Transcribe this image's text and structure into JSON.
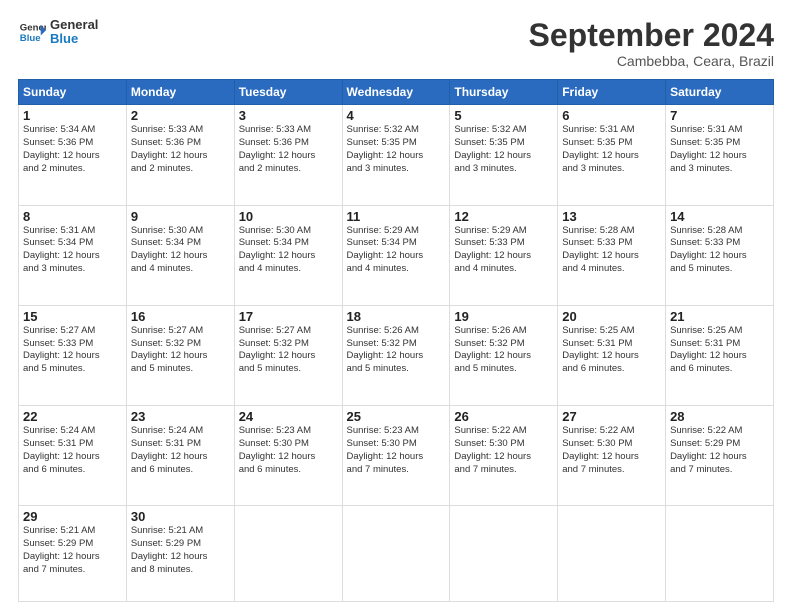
{
  "header": {
    "logo_general": "General",
    "logo_blue": "Blue",
    "month": "September 2024",
    "location": "Cambebba, Ceara, Brazil"
  },
  "days_of_week": [
    "Sunday",
    "Monday",
    "Tuesday",
    "Wednesday",
    "Thursday",
    "Friday",
    "Saturday"
  ],
  "weeks": [
    [
      {
        "day": "1",
        "lines": [
          "Sunrise: 5:34 AM",
          "Sunset: 5:36 PM",
          "Daylight: 12 hours",
          "and 2 minutes."
        ]
      },
      {
        "day": "2",
        "lines": [
          "Sunrise: 5:33 AM",
          "Sunset: 5:36 PM",
          "Daylight: 12 hours",
          "and 2 minutes."
        ]
      },
      {
        "day": "3",
        "lines": [
          "Sunrise: 5:33 AM",
          "Sunset: 5:36 PM",
          "Daylight: 12 hours",
          "and 2 minutes."
        ]
      },
      {
        "day": "4",
        "lines": [
          "Sunrise: 5:32 AM",
          "Sunset: 5:35 PM",
          "Daylight: 12 hours",
          "and 3 minutes."
        ]
      },
      {
        "day": "5",
        "lines": [
          "Sunrise: 5:32 AM",
          "Sunset: 5:35 PM",
          "Daylight: 12 hours",
          "and 3 minutes."
        ]
      },
      {
        "day": "6",
        "lines": [
          "Sunrise: 5:31 AM",
          "Sunset: 5:35 PM",
          "Daylight: 12 hours",
          "and 3 minutes."
        ]
      },
      {
        "day": "7",
        "lines": [
          "Sunrise: 5:31 AM",
          "Sunset: 5:35 PM",
          "Daylight: 12 hours",
          "and 3 minutes."
        ]
      }
    ],
    [
      {
        "day": "8",
        "lines": [
          "Sunrise: 5:31 AM",
          "Sunset: 5:34 PM",
          "Daylight: 12 hours",
          "and 3 minutes."
        ]
      },
      {
        "day": "9",
        "lines": [
          "Sunrise: 5:30 AM",
          "Sunset: 5:34 PM",
          "Daylight: 12 hours",
          "and 4 minutes."
        ]
      },
      {
        "day": "10",
        "lines": [
          "Sunrise: 5:30 AM",
          "Sunset: 5:34 PM",
          "Daylight: 12 hours",
          "and 4 minutes."
        ]
      },
      {
        "day": "11",
        "lines": [
          "Sunrise: 5:29 AM",
          "Sunset: 5:34 PM",
          "Daylight: 12 hours",
          "and 4 minutes."
        ]
      },
      {
        "day": "12",
        "lines": [
          "Sunrise: 5:29 AM",
          "Sunset: 5:33 PM",
          "Daylight: 12 hours",
          "and 4 minutes."
        ]
      },
      {
        "day": "13",
        "lines": [
          "Sunrise: 5:28 AM",
          "Sunset: 5:33 PM",
          "Daylight: 12 hours",
          "and 4 minutes."
        ]
      },
      {
        "day": "14",
        "lines": [
          "Sunrise: 5:28 AM",
          "Sunset: 5:33 PM",
          "Daylight: 12 hours",
          "and 5 minutes."
        ]
      }
    ],
    [
      {
        "day": "15",
        "lines": [
          "Sunrise: 5:27 AM",
          "Sunset: 5:33 PM",
          "Daylight: 12 hours",
          "and 5 minutes."
        ]
      },
      {
        "day": "16",
        "lines": [
          "Sunrise: 5:27 AM",
          "Sunset: 5:32 PM",
          "Daylight: 12 hours",
          "and 5 minutes."
        ]
      },
      {
        "day": "17",
        "lines": [
          "Sunrise: 5:27 AM",
          "Sunset: 5:32 PM",
          "Daylight: 12 hours",
          "and 5 minutes."
        ]
      },
      {
        "day": "18",
        "lines": [
          "Sunrise: 5:26 AM",
          "Sunset: 5:32 PM",
          "Daylight: 12 hours",
          "and 5 minutes."
        ]
      },
      {
        "day": "19",
        "lines": [
          "Sunrise: 5:26 AM",
          "Sunset: 5:32 PM",
          "Daylight: 12 hours",
          "and 5 minutes."
        ]
      },
      {
        "day": "20",
        "lines": [
          "Sunrise: 5:25 AM",
          "Sunset: 5:31 PM",
          "Daylight: 12 hours",
          "and 6 minutes."
        ]
      },
      {
        "day": "21",
        "lines": [
          "Sunrise: 5:25 AM",
          "Sunset: 5:31 PM",
          "Daylight: 12 hours",
          "and 6 minutes."
        ]
      }
    ],
    [
      {
        "day": "22",
        "lines": [
          "Sunrise: 5:24 AM",
          "Sunset: 5:31 PM",
          "Daylight: 12 hours",
          "and 6 minutes."
        ]
      },
      {
        "day": "23",
        "lines": [
          "Sunrise: 5:24 AM",
          "Sunset: 5:31 PM",
          "Daylight: 12 hours",
          "and 6 minutes."
        ]
      },
      {
        "day": "24",
        "lines": [
          "Sunrise: 5:23 AM",
          "Sunset: 5:30 PM",
          "Daylight: 12 hours",
          "and 6 minutes."
        ]
      },
      {
        "day": "25",
        "lines": [
          "Sunrise: 5:23 AM",
          "Sunset: 5:30 PM",
          "Daylight: 12 hours",
          "and 7 minutes."
        ]
      },
      {
        "day": "26",
        "lines": [
          "Sunrise: 5:22 AM",
          "Sunset: 5:30 PM",
          "Daylight: 12 hours",
          "and 7 minutes."
        ]
      },
      {
        "day": "27",
        "lines": [
          "Sunrise: 5:22 AM",
          "Sunset: 5:30 PM",
          "Daylight: 12 hours",
          "and 7 minutes."
        ]
      },
      {
        "day": "28",
        "lines": [
          "Sunrise: 5:22 AM",
          "Sunset: 5:29 PM",
          "Daylight: 12 hours",
          "and 7 minutes."
        ]
      }
    ],
    [
      {
        "day": "29",
        "lines": [
          "Sunrise: 5:21 AM",
          "Sunset: 5:29 PM",
          "Daylight: 12 hours",
          "and 7 minutes."
        ]
      },
      {
        "day": "30",
        "lines": [
          "Sunrise: 5:21 AM",
          "Sunset: 5:29 PM",
          "Daylight: 12 hours",
          "and 8 minutes."
        ]
      },
      {
        "day": "",
        "lines": []
      },
      {
        "day": "",
        "lines": []
      },
      {
        "day": "",
        "lines": []
      },
      {
        "day": "",
        "lines": []
      },
      {
        "day": "",
        "lines": []
      }
    ]
  ]
}
